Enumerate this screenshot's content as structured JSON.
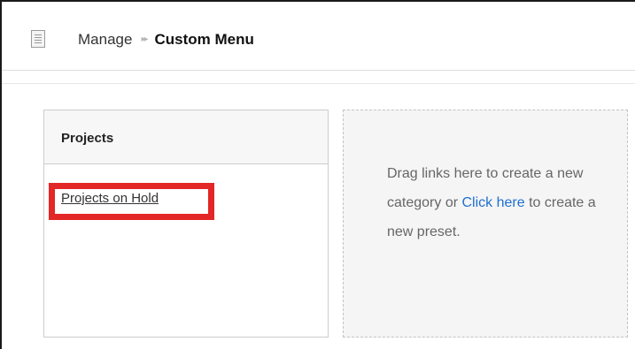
{
  "breadcrumb": {
    "icon": "page-icon",
    "root": "Manage",
    "separator": "▸▸",
    "current": "Custom Menu"
  },
  "category": {
    "title": "Projects",
    "links": [
      "Projects on Hold"
    ]
  },
  "drop_zone": {
    "text_before": "Drag links here to create a new category or ",
    "link_text": "Click here",
    "text_after": " to create a new preset."
  },
  "colors": {
    "highlight": "#e32626",
    "link": "#1f6fd0"
  }
}
